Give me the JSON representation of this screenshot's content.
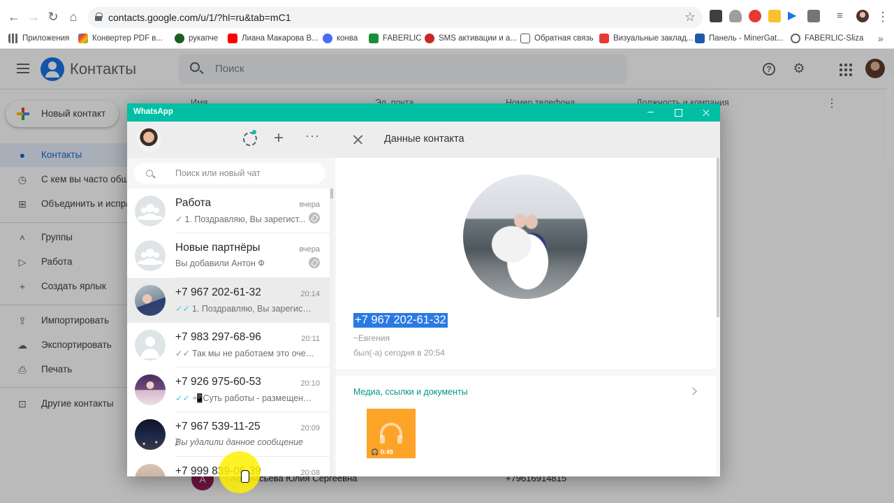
{
  "browser": {
    "url": "contacts.google.com/u/1/?hl=ru&tab=mC1",
    "bookmarks": [
      "Приложения",
      "Конвертер PDF в...",
      "рукапче",
      "Лиана Макарова В...",
      "конва",
      "FABERLIC",
      "SMS активации и а...",
      "Обратная связь",
      "Визуальные заклад...",
      "Панель - MinerGat...",
      "FABERLIC-Sliza"
    ],
    "extension_colors": [
      "#3c4043",
      "#9e9e9e",
      "#e53935",
      "#fbc02d",
      "#1a73e8",
      "#757575",
      "#616161"
    ]
  },
  "contacts_app": {
    "title": "Контакты",
    "search_placeholder": "Поиск",
    "new_contact": "Новый контакт",
    "sidebar": [
      {
        "label": "Контакты",
        "icon": "person-icon"
      },
      {
        "label": "С кем вы часто общ",
        "icon": "history-icon"
      },
      {
        "label": "Объединить и испра",
        "icon": "merge-icon"
      },
      {
        "label": "Группы",
        "icon": "chevron-up-icon"
      },
      {
        "label": "Работа",
        "icon": "label-icon"
      },
      {
        "label": "Создать ярлык",
        "icon": "plus-icon"
      },
      {
        "label": "Импортировать",
        "icon": "upload-icon"
      },
      {
        "label": "Экспортировать",
        "icon": "cloud-download-icon"
      },
      {
        "label": "Печать",
        "icon": "print-icon"
      },
      {
        "label": "Другие контакты",
        "icon": "archive-icon"
      }
    ],
    "columns": [
      "Имя",
      "Эл. почта",
      "Номер телефона",
      "Должность и компания"
    ],
    "visible_row": {
      "avatar_letter": "А",
      "name_highlight": "Аф",
      "name_rest": "анасьева Юлия Сергеевна",
      "phone": "+79616914815"
    }
  },
  "whatsapp": {
    "window_title": "WhatsApp",
    "search_placeholder": "Поиск или новый чат",
    "chats": [
      {
        "name": "Работа",
        "time": "вчера",
        "last": "1. Поздравляю, Вы зарегист...",
        "tick": "✓",
        "tick_read": false,
        "avatar": "group",
        "muted": true,
        "italic": false
      },
      {
        "name": "Новые партнёры",
        "time": "вчера",
        "last": "Вы добавили Антон Ф",
        "tick": "",
        "tick_read": false,
        "avatar": "group",
        "muted": true,
        "italic": false
      },
      {
        "name": "+7 967 202-61-32",
        "time": "20:14",
        "last": "1. Поздравляю, Вы зарегистри...",
        "tick": "✓✓",
        "tick_read": true,
        "avatar": "photo1",
        "muted": false,
        "italic": false
      },
      {
        "name": "+7 983 297-68-96",
        "time": "20:11",
        "last": "Так мы не работаем это очень...",
        "tick": "✓✓",
        "tick_read": false,
        "avatar": "person",
        "muted": false,
        "italic": false
      },
      {
        "name": "+7 926 975-60-53",
        "time": "20:10",
        "last": "📲Суть работы - размещение...",
        "tick": "✓✓",
        "tick_read": true,
        "avatar": "photo2",
        "muted": false,
        "italic": false
      },
      {
        "name": "+7 967 539-11-25",
        "time": "20:09",
        "last": "⃠Вы удалили данное сообщение",
        "tick": "",
        "tick_read": false,
        "avatar": "photo3",
        "muted": false,
        "italic": true
      },
      {
        "name": "+7 999 839-06-39",
        "time": "20:08",
        "last": "",
        "tick": "",
        "tick_read": false,
        "avatar": "photo4",
        "muted": false,
        "italic": false
      }
    ],
    "panel": {
      "title": "Данные контакта",
      "phone": "+7 967 202-61-32",
      "nickname": "~Евгения",
      "last_seen": "был(-а) сегодня в 20:54",
      "media_title": "Медиа, ссылки и документы",
      "audio_duration": "🎧 0:49"
    }
  }
}
